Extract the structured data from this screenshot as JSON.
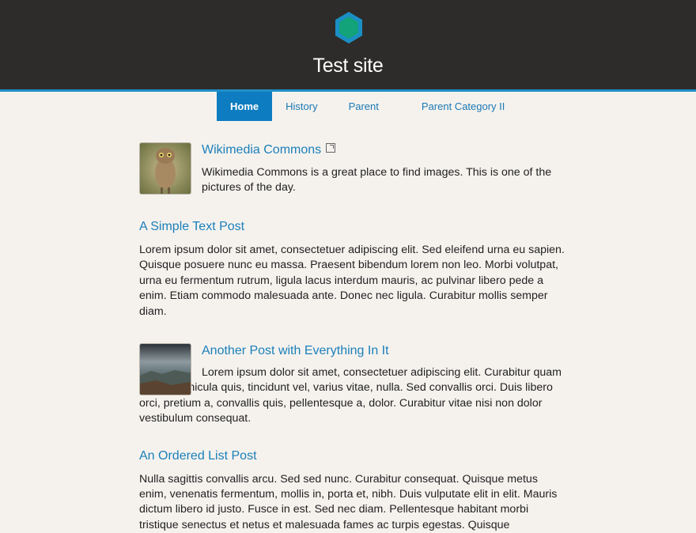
{
  "site": {
    "title": "Test site"
  },
  "nav": [
    {
      "label": "Home",
      "active": true
    },
    {
      "label": "History",
      "active": false
    },
    {
      "label": "Parent",
      "active": false
    },
    {
      "label": "Parent Category II",
      "active": false
    }
  ],
  "posts": [
    {
      "title": "Wikimedia Commons",
      "external": true,
      "thumb": "owl-photo",
      "text": "Wikimedia Commons is a great place to find images. This is one of the pictures of the day."
    },
    {
      "title": "A Simple Text Post",
      "text": "Lorem ipsum dolor sit amet, consectetuer adipiscing elit. Sed eleifend urna eu sapien. Quisque posuere nunc eu massa. Praesent bibendum lorem non leo. Morbi volutpat, urna eu fermentum rutrum, ligula lacus interdum mauris, ac pulvinar libero pede a enim. Etiam commodo malesuada ante. Donec nec ligula. Curabitur mollis semper diam."
    },
    {
      "title": "Another Post with Everything In It",
      "thumb": "landscape-photo",
      "text": "Lorem ipsum dolor sit amet, consectetuer adipiscing elit. Curabitur quam augue, vehicula quis, tincidunt vel, varius vitae, nulla. Sed convallis orci. Duis libero orci, pretium a, convallis quis, pellentesque a, dolor. Curabitur vitae nisi non dolor vestibulum consequat."
    },
    {
      "title": "An Ordered List Post",
      "text": "Nulla sagittis convallis arcu. Sed sed nunc. Curabitur consequat. Quisque metus enim, venenatis fermentum, mollis in, porta et, nibh. Duis vulputate elit in elit. Mauris dictum libero id justo. Fusce in est. Sed nec diam. Pellentesque habitant morbi tristique senectus et netus et malesuada fames ac turpis egestas. Quisque"
    }
  ],
  "colors": {
    "header": "#2d2c2a",
    "accent": "#1f8ec7",
    "link": "#1b7fb9",
    "background": "#f5f2ee"
  }
}
